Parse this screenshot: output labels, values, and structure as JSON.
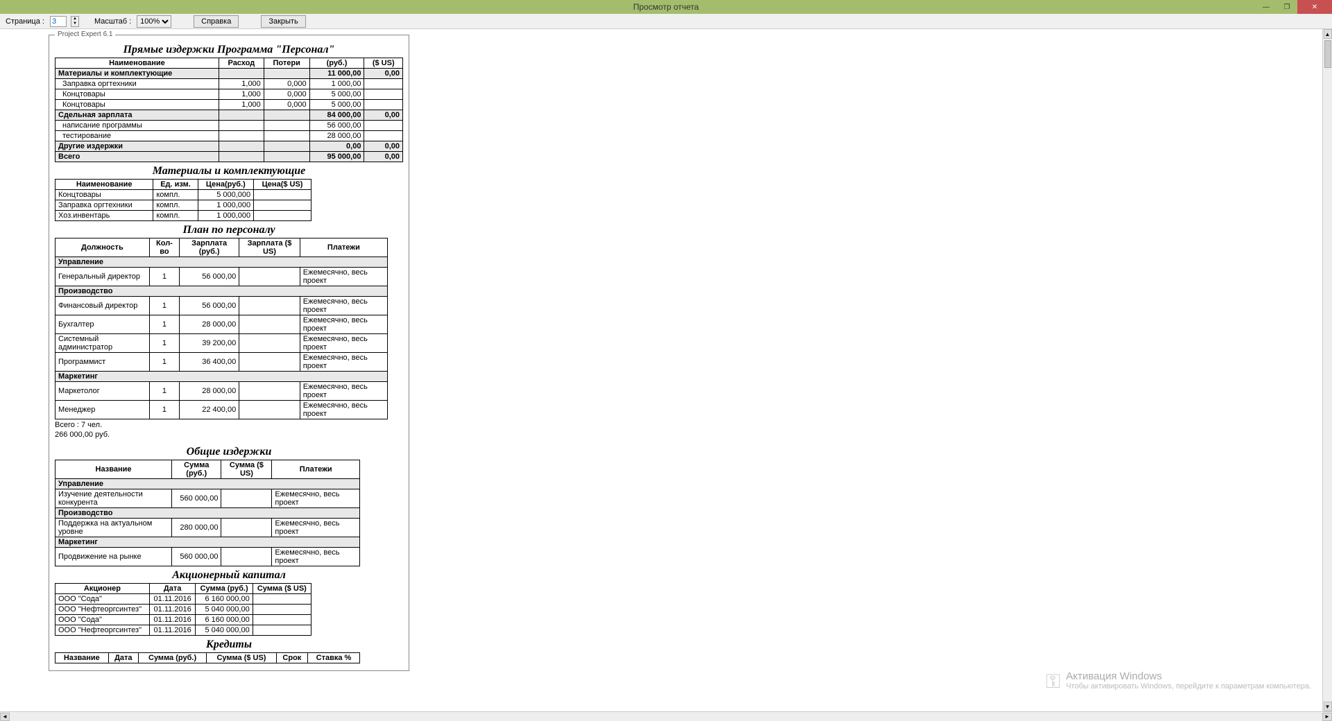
{
  "window": {
    "title": "Просмотр отчета"
  },
  "toolbar": {
    "page_label": "Страница :",
    "page_value": "3",
    "zoom_label": "Масштаб :",
    "zoom_value": "100%",
    "help": "Справка",
    "close": "Закрыть"
  },
  "fieldset_label": "Project Expert 6.1",
  "sections": {
    "direct_costs": {
      "title": "Прямые издержки Программа \"Персонал\"",
      "headers": [
        "Наименование",
        "Расход",
        "Потери",
        "(руб.)",
        "($ US)"
      ],
      "groups": [
        {
          "name": "Материалы и комплектующие",
          "rub": "11 000,00",
          "usd": "0,00",
          "rows": [
            {
              "name": "Заправка оргтехники",
              "rash": "1,000",
              "poteri": "0,000",
              "rub": "1 000,00",
              "usd": ""
            },
            {
              "name": "Концтовары",
              "rash": "1,000",
              "poteri": "0,000",
              "rub": "5 000,00",
              "usd": ""
            },
            {
              "name": "Концтовары",
              "rash": "1,000",
              "poteri": "0,000",
              "rub": "5 000,00",
              "usd": ""
            }
          ]
        },
        {
          "name": "Сдельная зарплата",
          "rub": "84 000,00",
          "usd": "0,00",
          "rows": [
            {
              "name": "написание программы",
              "rash": "",
              "poteri": "",
              "rub": "56 000,00",
              "usd": ""
            },
            {
              "name": "тестирование",
              "rash": "",
              "poteri": "",
              "rub": "28 000,00",
              "usd": ""
            }
          ]
        },
        {
          "name": "Другие издержки",
          "rub": "0,00",
          "usd": "0,00",
          "rows": []
        },
        {
          "name": "Всего",
          "rub": "95 000,00",
          "usd": "0,00",
          "rows": []
        }
      ]
    },
    "materials": {
      "title": "Материалы и комплектующие",
      "headers": [
        "Наименование",
        "Ед. изм.",
        "Цена(руб.)",
        "Цена($ US)"
      ],
      "rows": [
        {
          "name": "Концтовары",
          "unit": "компл.",
          "rub": "5 000,000",
          "usd": ""
        },
        {
          "name": "Заправка оргтехники",
          "unit": "компл.",
          "rub": "1 000,000",
          "usd": ""
        },
        {
          "name": "Хоз.инвентарь",
          "unit": "компл.",
          "rub": "1 000,000",
          "usd": ""
        }
      ]
    },
    "personnel": {
      "title": "План по персоналу",
      "headers": [
        "Должность",
        "Кол-во",
        "Зарплата (руб.)",
        "Зарплата ($ US)",
        "Платежи"
      ],
      "groups": [
        {
          "name": "Управление",
          "rows": [
            {
              "pos": "Генеральный директор",
              "cnt": "1",
              "rub": "56 000,00",
              "usd": "",
              "pay": "Ежемесячно, весь проект"
            }
          ]
        },
        {
          "name": "Производство",
          "rows": [
            {
              "pos": "Финансовый директор",
              "cnt": "1",
              "rub": "56 000,00",
              "usd": "",
              "pay": "Ежемесячно, весь проект"
            },
            {
              "pos": "Бухгалтер",
              "cnt": "1",
              "rub": "28 000,00",
              "usd": "",
              "pay": "Ежемесячно, весь проект"
            },
            {
              "pos": "Системный администратор",
              "cnt": "1",
              "rub": "39 200,00",
              "usd": "",
              "pay": "Ежемесячно, весь проект"
            },
            {
              "pos": "Программист",
              "cnt": "1",
              "rub": "36 400,00",
              "usd": "",
              "pay": "Ежемесячно, весь проект"
            }
          ]
        },
        {
          "name": "Маркетинг",
          "rows": [
            {
              "pos": "Маркетолог",
              "cnt": "1",
              "rub": "28 000,00",
              "usd": "",
              "pay": "Ежемесячно, весь проект"
            },
            {
              "pos": "Менеджер",
              "cnt": "1",
              "rub": "22 400,00",
              "usd": "",
              "pay": "Ежемесячно, весь проект"
            }
          ]
        }
      ],
      "total1": "Всего : 7 чел.",
      "total2": "266 000,00 руб."
    },
    "common_costs": {
      "title": "Общие издержки",
      "headers": [
        "Название",
        "Сумма (руб.)",
        "Сумма ($ US)",
        "Платежи"
      ],
      "groups": [
        {
          "name": "Управление",
          "rows": [
            {
              "name": "Изучение деятельности конкурента",
              "rub": "560 000,00",
              "usd": "",
              "pay": "Ежемесячно, весь проект"
            }
          ]
        },
        {
          "name": "Производство",
          "rows": [
            {
              "name": "Поддержка на актуальном уровне",
              "rub": "280 000,00",
              "usd": "",
              "pay": "Ежемесячно, весь проект"
            }
          ]
        },
        {
          "name": "Маркетинг",
          "rows": [
            {
              "name": "Продвижение на рынке",
              "rub": "560 000,00",
              "usd": "",
              "pay": "Ежемесячно, весь проект"
            }
          ]
        }
      ]
    },
    "capital": {
      "title": "Акционерный капитал",
      "headers": [
        "Акционер",
        "Дата",
        "Сумма (руб.)",
        "Сумма ($ US)"
      ],
      "rows": [
        {
          "name": "ООО \"Сода\"",
          "date": "01.11.2016",
          "rub": "6 160 000,00",
          "usd": ""
        },
        {
          "name": "ООО \"Нефтеоргсинтез\"",
          "date": "01.11.2016",
          "rub": "5 040 000,00",
          "usd": ""
        },
        {
          "name": "ООО \"Сода\"",
          "date": "01.11.2016",
          "rub": "6 160 000,00",
          "usd": ""
        },
        {
          "name": "ООО \"Нефтеоргсинтез\"",
          "date": "01.11.2016",
          "rub": "5 040 000,00",
          "usd": ""
        }
      ]
    },
    "credits": {
      "title": "Кредиты",
      "headers": [
        "Название",
        "Дата",
        "Сумма (руб.)",
        "Сумма ($ US)",
        "Срок",
        "Ставка %"
      ]
    }
  },
  "watermark": {
    "line1": "Активация Windows",
    "line2": "Чтобы активировать Windows, перейдите к параметрам компьютера."
  }
}
